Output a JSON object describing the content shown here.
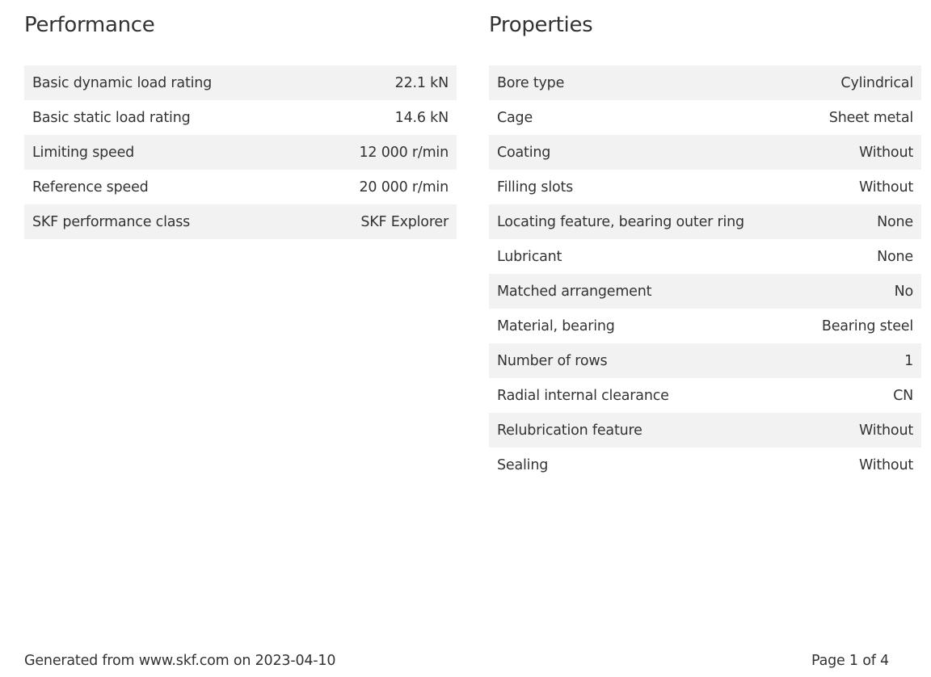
{
  "performance": {
    "title": "Performance",
    "rows": [
      {
        "label": "Basic dynamic load rating",
        "value": "22.1 kN"
      },
      {
        "label": "Basic static load rating",
        "value": "14.6 kN"
      },
      {
        "label": "Limiting speed",
        "value": "12 000 r/min"
      },
      {
        "label": "Reference speed",
        "value": "20 000 r/min"
      },
      {
        "label": "SKF performance class",
        "value": "SKF Explorer"
      }
    ]
  },
  "properties": {
    "title": "Properties",
    "rows": [
      {
        "label": "Bore type",
        "value": "Cylindrical"
      },
      {
        "label": "Cage",
        "value": "Sheet metal"
      },
      {
        "label": "Coating",
        "value": "Without"
      },
      {
        "label": "Filling slots",
        "value": "Without"
      },
      {
        "label": "Locating feature, bearing outer ring",
        "value": "None"
      },
      {
        "label": "Lubricant",
        "value": "None"
      },
      {
        "label": "Matched arrangement",
        "value": "No"
      },
      {
        "label": "Material, bearing",
        "value": "Bearing steel"
      },
      {
        "label": "Number of rows",
        "value": "1"
      },
      {
        "label": "Radial internal clearance",
        "value": "CN"
      },
      {
        "label": "Relubrication feature",
        "value": "Without"
      },
      {
        "label": "Sealing",
        "value": "Without"
      }
    ]
  },
  "footer": {
    "generated": "Generated from www.skf.com on 2023-04-10",
    "page": "Page 1 of 4"
  }
}
